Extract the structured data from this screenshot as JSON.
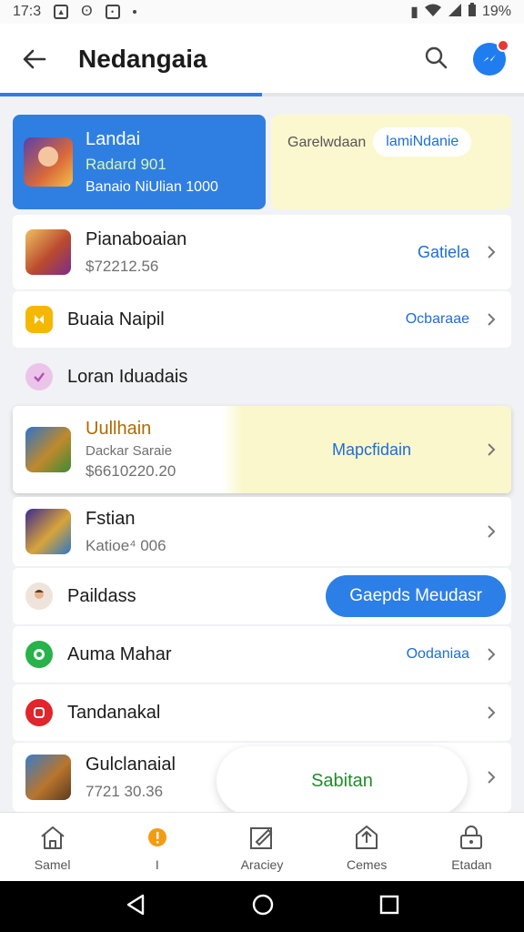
{
  "status_bar": {
    "time": "17:3",
    "battery": "19%"
  },
  "app_bar": {
    "title": "Nedangaia"
  },
  "promo": {
    "blue": {
      "title": "Landai",
      "subtitle": "Radard 901",
      "detail": "Banaio NiUlian 1000"
    },
    "yellow": {
      "label": "Garelwdaan",
      "pill": "lamiNdanie"
    }
  },
  "list": {
    "items": [
      {
        "name": "Pianaboaian",
        "sub": "$72212.56",
        "action": "Gatiela"
      },
      {
        "name": "Buaia Naipil",
        "action": "Ocbaraae"
      },
      {
        "name": "Loran Iduadais"
      },
      {
        "name": "Uullhain",
        "sub": "Dackar Saraie",
        "sub2": "$6610220.20",
        "action": "Mapcfidain"
      },
      {
        "name": "Fstian",
        "sub": "Katioe⁴ 006"
      },
      {
        "name": "Paildass",
        "action": "Gaepds Meudasr"
      },
      {
        "name": "Auma Mahar",
        "action": "Oodaniaa"
      },
      {
        "name": "Tandanakal"
      },
      {
        "name": "Gulclanaial",
        "sub": "7721 30.36"
      }
    ]
  },
  "floating": {
    "label": "Sabitan"
  },
  "bottom_nav": {
    "items": [
      {
        "label": "Samel",
        "icon": "home-icon"
      },
      {
        "label": "I",
        "icon": "alert-icon"
      },
      {
        "label": "Araciey",
        "icon": "edit-icon"
      },
      {
        "label": "Cemes",
        "icon": "upload-icon"
      },
      {
        "label": "Etadan",
        "icon": "lock-icon"
      }
    ]
  },
  "colors": {
    "accent": "#2f7de1",
    "promo_yellow": "#fbf8cf",
    "link": "#1e6ed2"
  }
}
